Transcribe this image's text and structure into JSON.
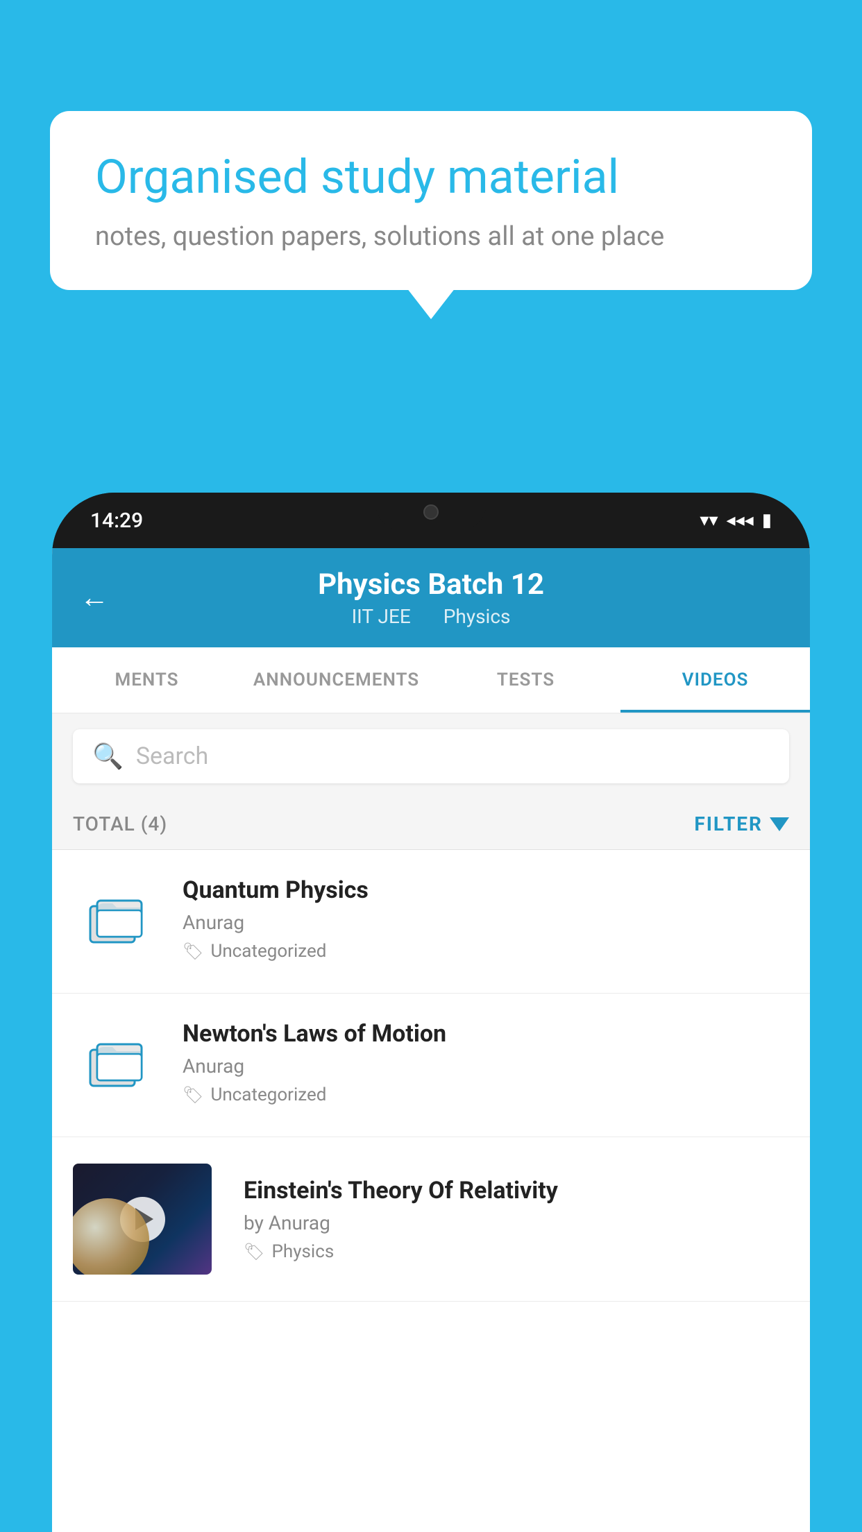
{
  "background_color": "#29b9e8",
  "bubble": {
    "title": "Organised study material",
    "subtitle": "notes, question papers, solutions all at one place"
  },
  "phone": {
    "time": "14:29",
    "header": {
      "title": "Physics Batch 12",
      "subtitle_left": "IIT JEE",
      "subtitle_right": "Physics"
    },
    "tabs": [
      {
        "label": "MENTS",
        "active": false
      },
      {
        "label": "ANNOUNCEMENTS",
        "active": false
      },
      {
        "label": "TESTS",
        "active": false
      },
      {
        "label": "VIDEOS",
        "active": true
      }
    ],
    "search": {
      "placeholder": "Search"
    },
    "filter": {
      "total_label": "TOTAL (4)",
      "filter_label": "FILTER"
    },
    "videos": [
      {
        "id": 1,
        "title": "Quantum Physics",
        "author": "Anurag",
        "tag": "Uncategorized",
        "type": "folder"
      },
      {
        "id": 2,
        "title": "Newton's Laws of Motion",
        "author": "Anurag",
        "tag": "Uncategorized",
        "type": "folder"
      },
      {
        "id": 3,
        "title": "Einstein's Theory Of Relativity",
        "author": "by Anurag",
        "tag": "Physics",
        "type": "video"
      }
    ]
  }
}
